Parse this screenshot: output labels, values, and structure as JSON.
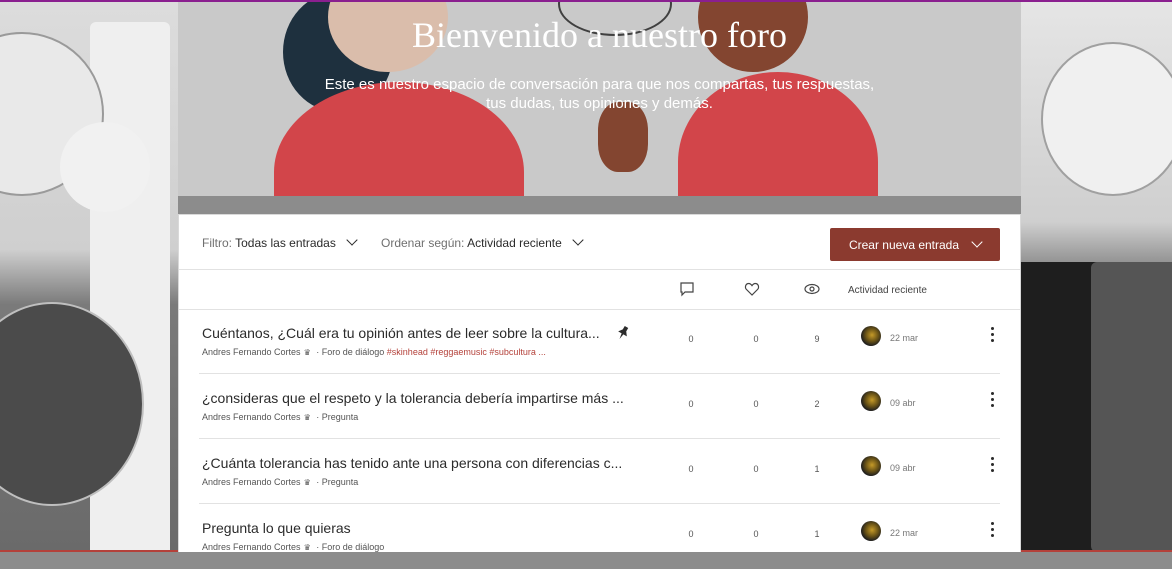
{
  "hero": {
    "title": "Bienvenido a nuestro foro",
    "subtitle": "Este es nuestro espacio de conversación para que nos compartas, tus respuestas, tus dudas, tus opiniones y demás."
  },
  "filters": {
    "filter_label": "Filtro:",
    "filter_value": "Todas las entradas",
    "sort_label": "Ordenar según:",
    "sort_value": "Actividad reciente",
    "create_button": "Crear nueva entrada"
  },
  "columns": {
    "comments_icon": "comment-icon",
    "likes_icon": "heart-icon",
    "views_icon": "eye-icon",
    "activity": "Actividad reciente"
  },
  "posts": [
    {
      "title": "Cuéntanos, ¿Cuál era tu opinión antes de leer sobre la cultura...",
      "author": "Andres Fernando Cortes",
      "category": "Foro de diálogo",
      "tags": "#skinhead #reggaemusic #subcultura ...",
      "pinned": true,
      "comments": "0",
      "likes": "0",
      "views": "9",
      "date": "22 mar"
    },
    {
      "title": "¿consideras que el respeto y la tolerancia debería impartirse más ...",
      "author": "Andres Fernando Cortes",
      "category": "Pregunta",
      "tags": "",
      "pinned": false,
      "comments": "0",
      "likes": "0",
      "views": "2",
      "date": "09 abr"
    },
    {
      "title": "¿Cuánta tolerancia has tenido ante una persona con diferencias c...",
      "author": "Andres Fernando Cortes",
      "category": "Pregunta",
      "tags": "",
      "pinned": false,
      "comments": "0",
      "likes": "0",
      "views": "1",
      "date": "09 abr"
    },
    {
      "title": "Pregunta lo que quieras",
      "author": "Andres Fernando Cortes",
      "category": "Foro de diálogo",
      "tags": "",
      "pinned": false,
      "comments": "0",
      "likes": "0",
      "views": "1",
      "date": "22 mar"
    }
  ],
  "colors": {
    "accent": "#8b3a2f",
    "tag": "#b4413a",
    "topline": "#8a1f8f"
  }
}
